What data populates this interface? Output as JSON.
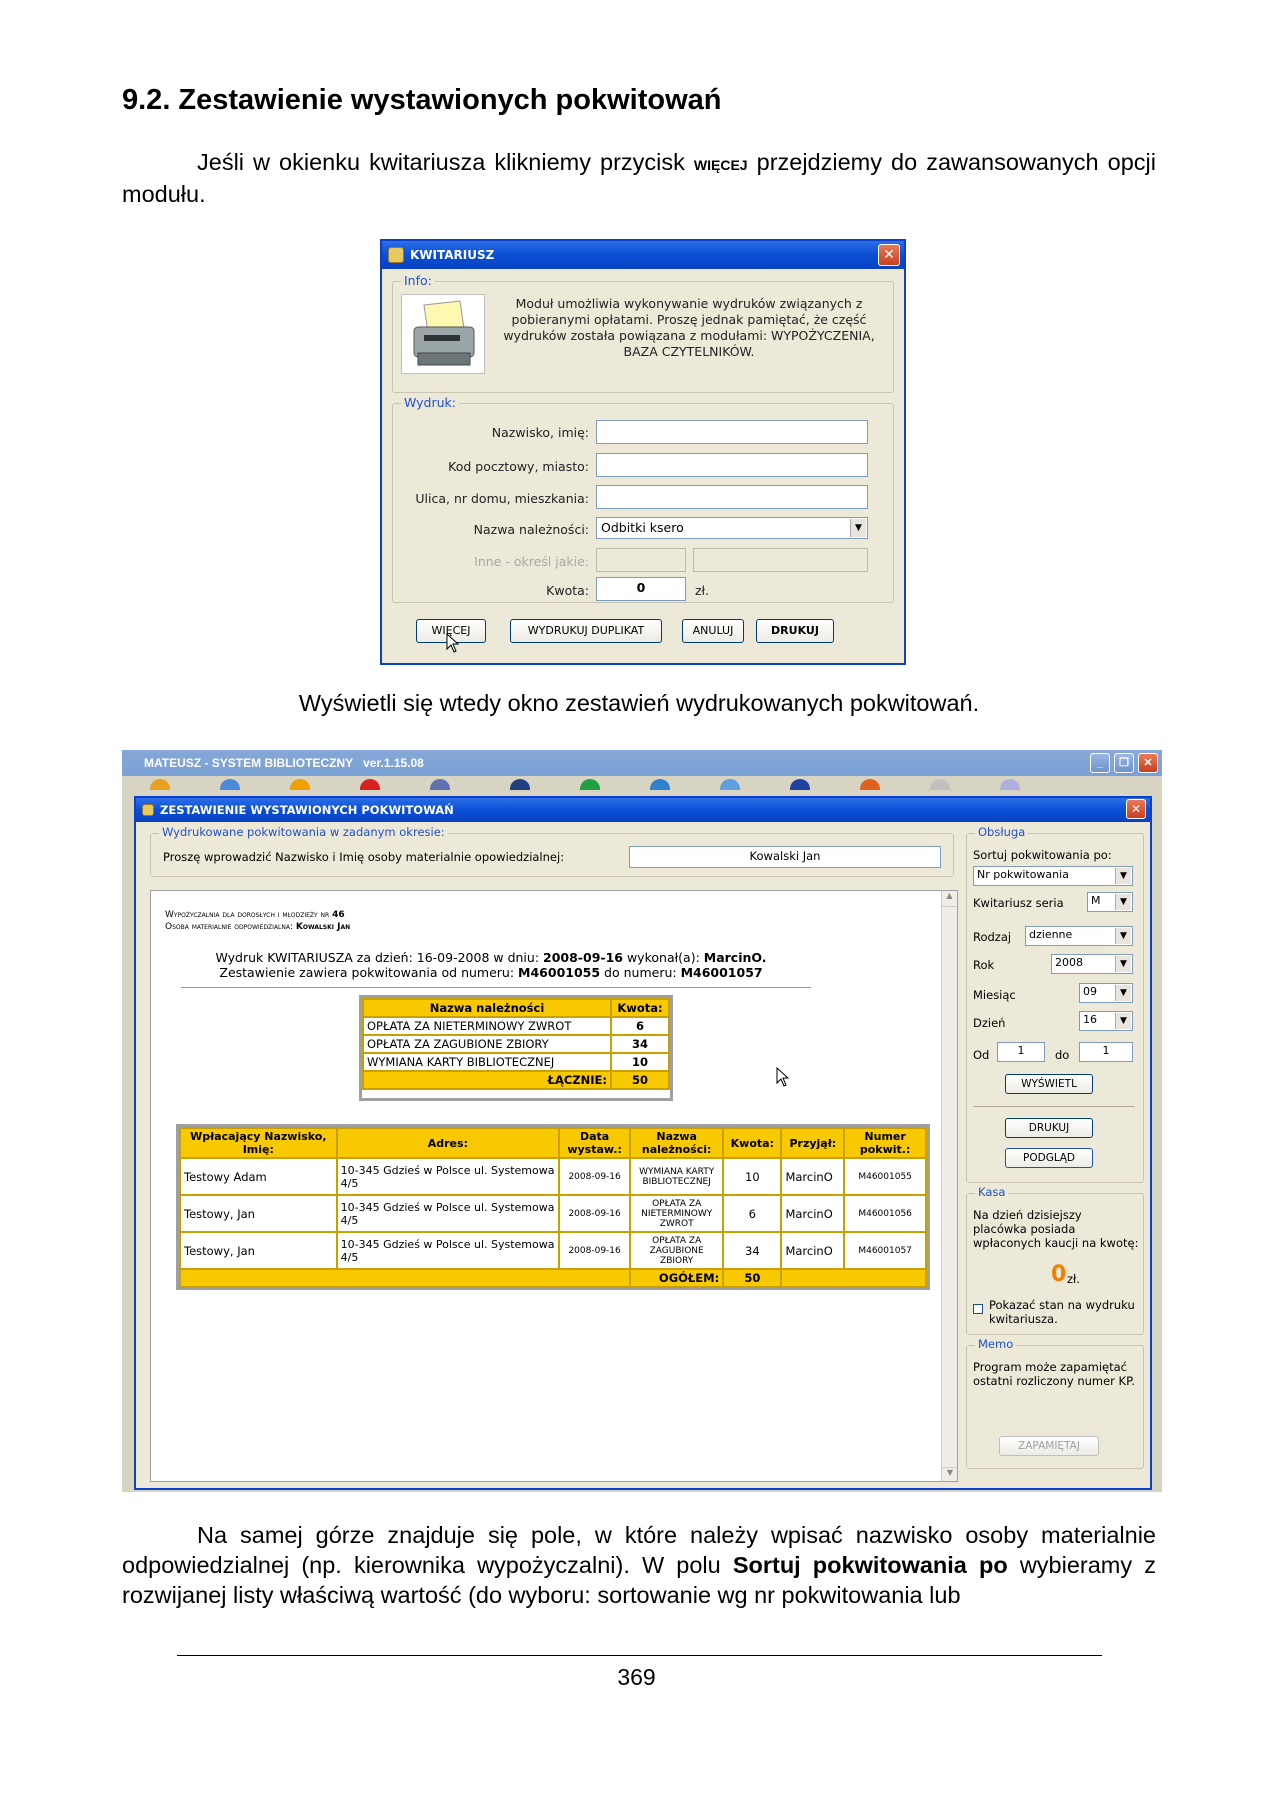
{
  "heading": "9.2. Zestawienie wystawionych pokwitowań",
  "intro": {
    "before": "Jeśli w okienku kwitariusza klikniemy przycisk ",
    "keyword": "więcej",
    "after": " przejdziemy do zawansowanych opcji modułu."
  },
  "kwit": {
    "title": "KWITARIUSZ",
    "info_legend": "Info:",
    "info_text": "Moduł umożliwia wykonywanie wydruków związanych z pobieranymi opłatami. Proszę jednak pamiętać, że część wydruków została powiązana z modułami: WYPOŻYCZENIA, BAZA CZYTELNIKÓW.",
    "wydruk_legend": "Wydruk:",
    "label_name": "Nazwisko, imię:",
    "label_postal": "Kod pocztowy, miasto:",
    "label_street": "Ulica, nr domu, mieszkania:",
    "label_fee": "Nazwa należności:",
    "fee_value": "Odbitki ksero",
    "label_other": "Inne - określ jakie:",
    "label_amount": "Kwota:",
    "amount_value": "0",
    "currency": "zł.",
    "btn_more": "WIĘCEJ",
    "btn_duplicate": "WYDRUKUJ DUPLIKAT",
    "btn_cancel": "ANULUJ",
    "btn_print": "DRUKUJ"
  },
  "caption": "Wyświetli się wtedy okno zestawień wydrukowanych pokwitowań.",
  "app": {
    "title": "MATEUSZ - SYSTEM BIBLIOTECZNY",
    "version": "ver.1.15.08"
  },
  "zest": {
    "title": "ZESTAWIENIE WYSTAWIONYCH POKWITOWAŃ",
    "period_legend": "Wydrukowane pokwitowania w zadanym okresie:",
    "person_label": "Proszę wprowadzić Nazwisko i Imię osoby materialnie opowiedzialnej:",
    "person_value": "Kowalski Jan",
    "report": {
      "line1_label": "Wypożyczalnia dla dorosłych i młodzieży nr",
      "line1_value": "46",
      "line2_label": "Osoba materialnie odpowiedzialna:",
      "line2_value": "Kowalski Jan",
      "print_line_a": "Wydruk KWITARIUSZA za dzień: 16-09-2008 w dniu: ",
      "print_date": "2008-09-16",
      "print_line_b": " wykonał(a): ",
      "print_user": "MarcinO.",
      "range_line_a": "Zestawienie zawiera pokwitowania od numeru: ",
      "range_from": "M46001055",
      "range_line_b": " do numeru: ",
      "range_to": "M46001057"
    },
    "summary": {
      "col_name": "Nazwa należności",
      "col_amount": "Kwota:",
      "rows": [
        {
          "name": "OPŁATA ZA NIETERMINOWY ZWROT",
          "amount": "6"
        },
        {
          "name": "OPŁATA ZA ZAGUBIONE ZBIORY",
          "amount": "34"
        },
        {
          "name": "WYMIANA KARTY BIBLIOTECZNEJ",
          "amount": "10"
        }
      ],
      "total_label": "ŁĄCZNIE:",
      "total": "50"
    },
    "details": {
      "headers": [
        "Wpłacający Nazwisko, Imię:",
        "Adres:",
        "Data wystaw.:",
        "Nazwa należności:",
        "Kwota:",
        "Przyjął:",
        "Numer pokwit.:"
      ],
      "rows": [
        [
          "Testowy Adam",
          "10-345 Gdzieś w Polsce ul. Systemowa 4/5",
          "2008-09-16",
          "WYMIANA KARTY BIBLIOTECZNEJ",
          "10",
          "MarcinO",
          "M46001055"
        ],
        [
          "Testowy, Jan",
          "10-345 Gdzieś w Polsce ul. Systemowa 4/5",
          "2008-09-16",
          "OPŁATA ZA NIETERMINOWY ZWROT",
          "6",
          "MarcinO",
          "M46001056"
        ],
        [
          "Testowy, Jan",
          "10-345 Gdzieś w Polsce ul. Systemowa 4/5",
          "2008-09-16",
          "OPŁATA ZA ZAGUBIONE ZBIORY",
          "34",
          "MarcinO",
          "M46001057"
        ]
      ],
      "total_label": "OGÓŁEM:",
      "total": "50"
    },
    "side": {
      "obsluga_legend": "Obsługa",
      "sort_label": "Sortuj pokwitowania po:",
      "sort_value": "Nr pokwitowania",
      "series_label": "Kwitariusz seria",
      "series_value": "M",
      "type_label": "Rodzaj",
      "type_value": "dzienne",
      "year_label": "Rok",
      "year_value": "2008",
      "month_label": "Miesiąc",
      "month_value": "09",
      "day_label": "Dzień",
      "day_value": "16",
      "from_label": "Od",
      "from_value": "1",
      "to_label": "do",
      "to_value": "1",
      "btn_show": "WYŚWIETL",
      "btn_print": "DRUKUJ",
      "btn_preview": "PODGLĄD",
      "kasa_legend": "Kasa",
      "kasa_text": "Na dzień dzisiejszy placówka posiada wpłaconych kaucji na kwotę:",
      "kasa_amount": "0",
      "kasa_currency": "zł.",
      "checkbox_label": "Pokazać stan na wydruku kwitariusza.",
      "memo_legend": "Memo",
      "memo_text": "Program może zapamiętać ostatni rozliczony numer KP.",
      "btn_remember": "ZAPAMIĘTAJ"
    }
  },
  "body_text": {
    "part1": "Na samej górze znajduje się pole, w które należy wpisać nazwisko osoby materialnie odpowiedzialnej (np. kierownika wypożyczalni). W polu ",
    "bold": "Sortuj pokwitowania po",
    "part2": " wybieramy z rozwijanej listy właściwą wartość (do wyboru: sortowanie wg nr pokwitowania lub"
  },
  "page_number": "369"
}
